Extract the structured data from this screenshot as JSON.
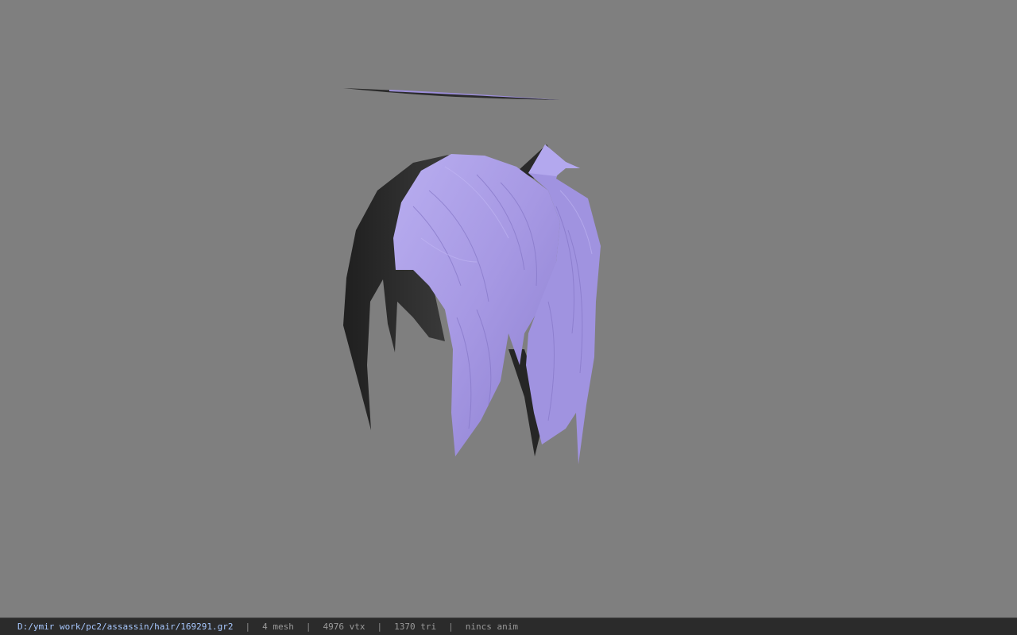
{
  "viewport": {
    "background_color": "#7f7f7f",
    "model": {
      "description_icon": "hair-mesh-render",
      "hair_color": "#a99be6",
      "shadow_color": "#2a2a2a"
    }
  },
  "status_bar": {
    "file_path": "D:/ymir work/pc2/assassin/hair/169291.gr2",
    "mesh_count": "4 mesh",
    "vertex_count": "4976 vtx",
    "triangle_count": "1370 tri",
    "anim_info": "nincs anim",
    "separator": "|"
  }
}
